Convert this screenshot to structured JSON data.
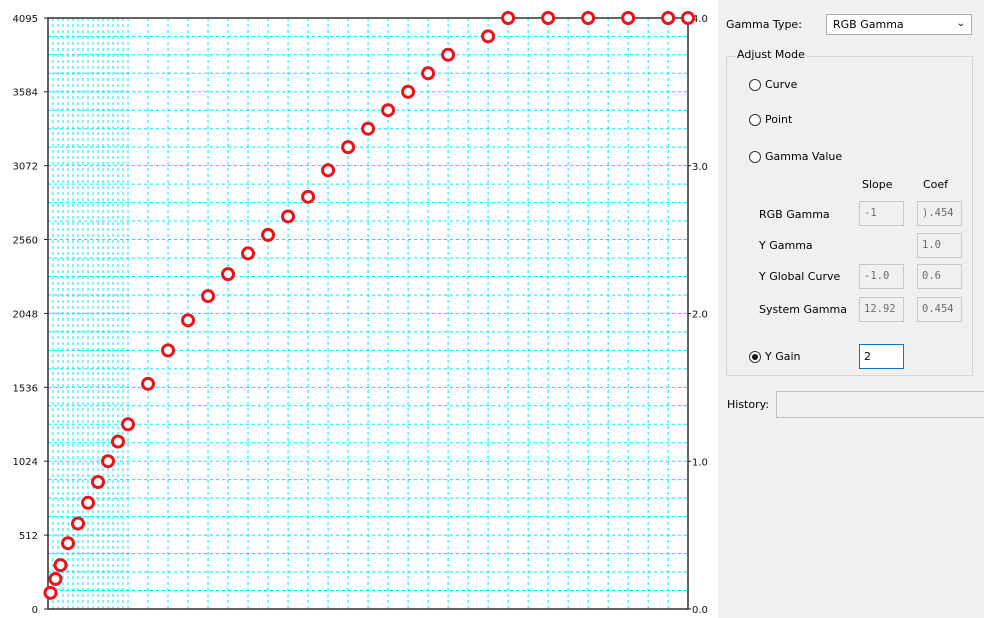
{
  "chart_data": {
    "type": "scatter",
    "left_axis": {
      "min": 0,
      "max": 4095,
      "ticks": [
        0,
        512,
        1024,
        1536,
        2048,
        2560,
        3072,
        3584,
        4095
      ]
    },
    "right_axis": {
      "min": 0.0,
      "max": 4.0,
      "ticks": [
        "0.0",
        "1.0",
        "2.0",
        "3.0",
        "4.0"
      ]
    },
    "x_range": [
      0,
      4095
    ],
    "grid": true,
    "marker": "hollow-circle",
    "marker_color": "#e8141a",
    "grid_color": "#00e5ff",
    "points": [
      [
        16,
        112
      ],
      [
        48,
        208
      ],
      [
        80,
        304
      ],
      [
        128,
        456
      ],
      [
        192,
        592
      ],
      [
        256,
        736
      ],
      [
        320,
        880
      ],
      [
        384,
        1024
      ],
      [
        448,
        1160
      ],
      [
        512,
        1280
      ],
      [
        640,
        1560
      ],
      [
        768,
        1792
      ],
      [
        896,
        2000
      ],
      [
        1024,
        2168
      ],
      [
        1152,
        2320
      ],
      [
        1280,
        2464
      ],
      [
        1408,
        2592
      ],
      [
        1536,
        2720
      ],
      [
        1664,
        2856
      ],
      [
        1792,
        3040
      ],
      [
        1920,
        3200
      ],
      [
        2048,
        3328
      ],
      [
        2176,
        3456
      ],
      [
        2304,
        3584
      ],
      [
        2432,
        3712
      ],
      [
        2560,
        3840
      ],
      [
        2816,
        3968
      ],
      [
        2944,
        4095
      ],
      [
        3200,
        4095
      ],
      [
        3456,
        4095
      ],
      [
        3712,
        4095
      ],
      [
        3968,
        4095
      ],
      [
        4095,
        4095
      ]
    ]
  },
  "panel": {
    "gamma_type_label": "Gamma Type:",
    "gamma_type_value": "RGB Gamma",
    "adjust_mode_title": "Adjust Mode",
    "radio_curve": "Curve",
    "radio_point": "Point",
    "radio_gamma_value": "Gamma Value",
    "col_slope": "Slope",
    "col_coef": "Coef",
    "rows": [
      {
        "label": "RGB Gamma",
        "slope": "-1",
        "coef": ").454"
      },
      {
        "label": "Y Gamma",
        "slope": "",
        "coef": "1.0"
      },
      {
        "label": "Y Global Curve",
        "slope": "-1.0",
        "coef": "0.6"
      },
      {
        "label": "System Gamma",
        "slope": "12.92",
        "coef": "0.454"
      }
    ],
    "radio_y_gain": "Y Gain",
    "y_gain_value": "2",
    "history_label": "History:"
  }
}
